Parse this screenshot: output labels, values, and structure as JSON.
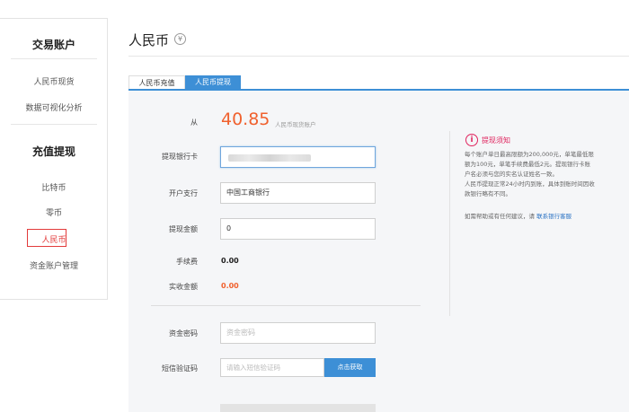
{
  "sidebar": {
    "section1_title": "交易账户",
    "section1_items": [
      "人民币现货",
      "数据可视化分析"
    ],
    "section2_title": "充值提现",
    "section2_items": [
      "比特币",
      "零币",
      "人民币",
      "资金账户管理"
    ],
    "active_item": "人民币"
  },
  "page": {
    "title": "人民币",
    "title_icon": "¥"
  },
  "tabs": [
    {
      "label": "人民币充值",
      "active": false
    },
    {
      "label": "人民币提现",
      "active": true
    }
  ],
  "form": {
    "from_label": "从",
    "from_amount": "40.85",
    "from_account": "人民币现货账户",
    "bank_card_label": "提现银行卡",
    "branch_label": "开户支行",
    "branch_value": "中国工商银行",
    "amount_label": "提现金额",
    "amount_value": "0",
    "fee_label": "手续费",
    "fee_value": "0.00",
    "actual_label": "实收金额",
    "actual_value": "0.00",
    "password_label": "资金密码",
    "password_placeholder": "资金密码",
    "sms_label": "短信验证码",
    "sms_placeholder": "请输入短信验证码",
    "sms_button": "点击获取"
  },
  "notice": {
    "title": "提现须知",
    "lines": [
      "每个账户单日最高限额为200,000元，单笔最低限",
      "额为100元，单笔手续费最低2元。提现银行卡账",
      "户名必须与您的实名认证姓名一致。",
      "人民币提现正常24小时内到账，具体到账时间因收",
      "款银行略有不同。"
    ],
    "help_text": "如需帮助或有任何建议，请",
    "help_link": "联系银行客服"
  },
  "colors": {
    "accent": "#3d8fd6",
    "amount": "#f0612e",
    "notice": "#e0245e",
    "active_sidebar": "#e23a3a"
  }
}
